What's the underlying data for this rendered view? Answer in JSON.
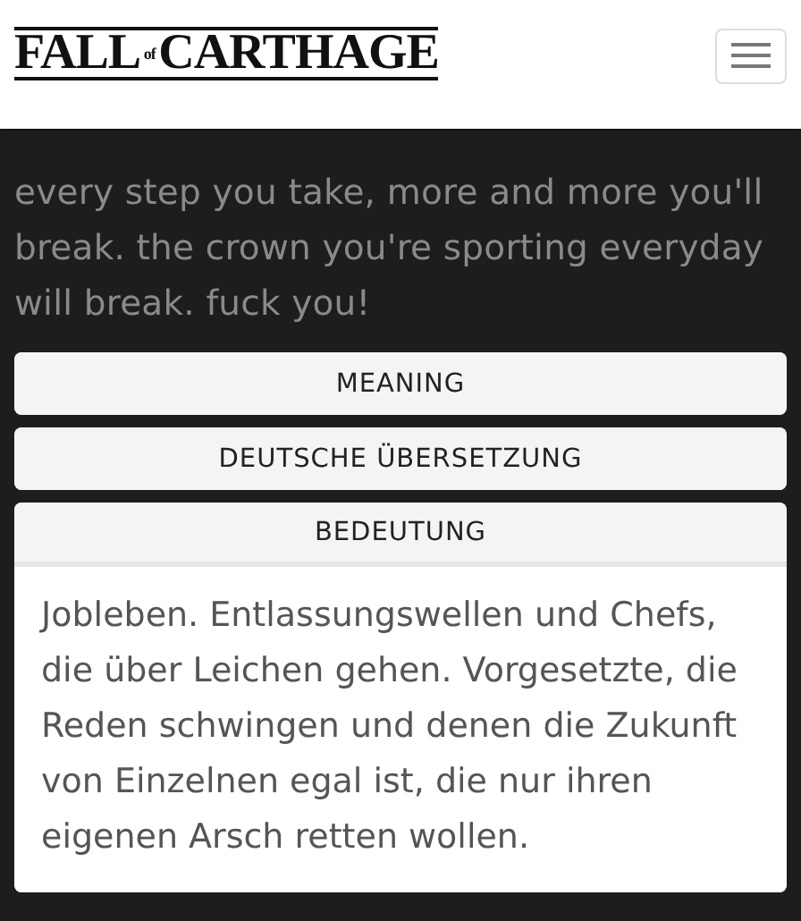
{
  "header": {
    "logo": {
      "main": "FALL",
      "small": "of",
      "rest": "CARTHAGE"
    }
  },
  "lyrics": "every step you take, more and more you'll\nbreak. the crown you're sporting everyday\nwill break. fuck you!",
  "accordion": [
    {
      "title": "MEANING",
      "expanded": false
    },
    {
      "title": "DEUTSCHE ÜBERSETZUNG",
      "expanded": false
    },
    {
      "title": "BEDEUTUNG",
      "expanded": true,
      "body": "Jobleben. Entlassungswellen und Chefs, die über Leichen gehen. Vorgesetzte, die Reden schwingen und denen die Zukunft von Einzelnen egal ist, die nur ihren eigenen Arsch retten wollen."
    }
  ]
}
